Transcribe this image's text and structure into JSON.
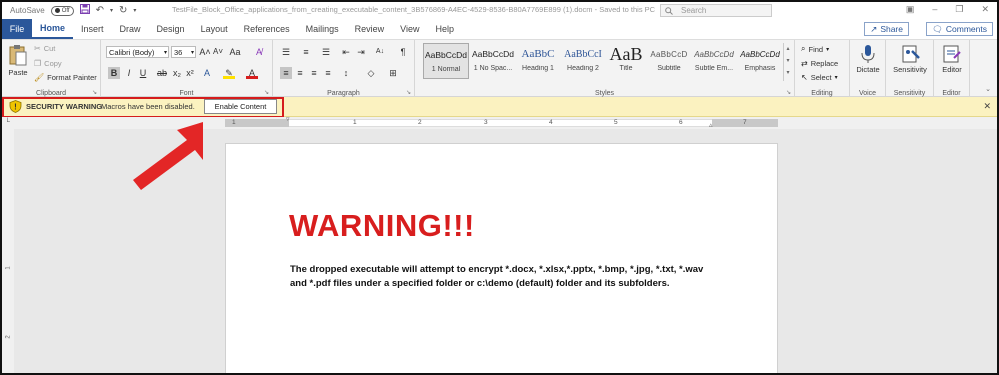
{
  "titlebar": {
    "autosave_label": "AutoSave",
    "autosave_state": "Off",
    "document_title": "TestFile_Block_Office_applications_from_creating_executable_content_3B576869-A4EC-4529-8536-B80A7769E899 (1).docm  -  Saved to this PC",
    "search_placeholder": "Search"
  },
  "tabs": {
    "file": "File",
    "items": [
      "Home",
      "Insert",
      "Draw",
      "Design",
      "Layout",
      "References",
      "Mailings",
      "Review",
      "View",
      "Help"
    ],
    "share": "Share",
    "comments": "Comments"
  },
  "ribbon": {
    "clipboard": {
      "label": "Clipboard",
      "paste": "Paste",
      "cut": "Cut",
      "copy": "Copy",
      "format_painter": "Format Painter"
    },
    "font": {
      "label": "Font",
      "font_name": "Calibri (Body)",
      "font_size": "36"
    },
    "paragraph": {
      "label": "Paragraph"
    },
    "styles": {
      "label": "Styles",
      "items": [
        {
          "preview": "AaBbCcDd",
          "name": "1 Normal"
        },
        {
          "preview": "AaBbCcDd",
          "name": "1 No Spac..."
        },
        {
          "preview": "AaBbC",
          "name": "Heading 1"
        },
        {
          "preview": "AaBbCcI",
          "name": "Heading 2"
        },
        {
          "preview": "AaB",
          "name": "Title"
        },
        {
          "preview": "AaBbCcD",
          "name": "Subtitle"
        },
        {
          "preview": "AaBbCcDd",
          "name": "Subtle Em..."
        },
        {
          "preview": "AaBbCcDd",
          "name": "Emphasis"
        }
      ]
    },
    "editing": {
      "label": "Editing",
      "find": "Find",
      "replace": "Replace",
      "select": "Select"
    },
    "voice": {
      "label": "Voice",
      "dictate": "Dictate"
    },
    "sensitivity": {
      "label": "Sensitivity",
      "button": "Sensitivity"
    },
    "editor": {
      "label": "Editor",
      "button": "Editor"
    }
  },
  "security_bar": {
    "title": "SECURITY WARNING",
    "message": "Macros have been disabled.",
    "button": "Enable Content"
  },
  "ruler": {
    "numbers": [
      "1",
      "1",
      "2",
      "3",
      "4",
      "5",
      "6",
      "7"
    ]
  },
  "vruler": {
    "numbers": [
      "1",
      "2"
    ]
  },
  "document": {
    "heading": "WARNING!!!",
    "body": "The dropped executable will attempt to encrypt *.docx, *.xlsx,*.pptx, *.bmp, *.jpg, *.txt, *.wav and *.pdf files under a specified folder or c:\\demo (default) folder and its subfolders."
  },
  "colors": {
    "accent": "#2b579a",
    "warning_bar": "#fbf2c0",
    "highlight_border": "#d51c1c",
    "heading_text": "#d81e1e"
  }
}
